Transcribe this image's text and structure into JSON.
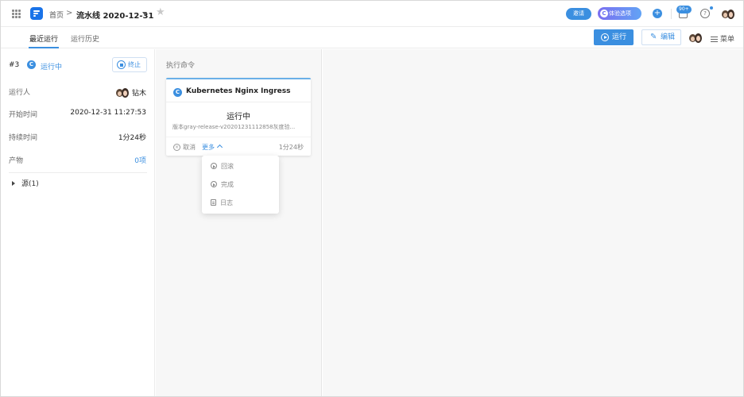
{
  "header": {
    "breadcrumb_home": "首页",
    "breadcrumb_sep": ">",
    "breadcrumb_current": "流水线 2020-12-31",
    "invite_label": "邀请",
    "trial_label": "体验选项",
    "trial_logo": "C",
    "plus_label": "+",
    "notif_badge": "90+",
    "help_label": "?"
  },
  "tabs": [
    {
      "label": "最近运行",
      "active": true
    },
    {
      "label": "运行历史",
      "active": false
    }
  ],
  "actions": {
    "run_label": "运行",
    "edit_label": "编辑",
    "edit_icon": "✎",
    "menu_label": "菜单"
  },
  "run": {
    "number": "#3",
    "status_icon": "C",
    "status": "运行中",
    "stop_label": "终止",
    "fields": [
      {
        "label": "运行人",
        "value": "钻木"
      },
      {
        "label": "开始时间",
        "value": "2020-12-31 11:27:53"
      },
      {
        "label": "持续时间",
        "value": "1分24秒"
      },
      {
        "label": "产物",
        "value": "0项"
      }
    ],
    "source_label": "源(1)"
  },
  "stage": {
    "title": "执行命令",
    "card": {
      "icon": "C",
      "title": "Kubernetes Nginx Ingress",
      "status": "运行中",
      "version": "版本gray-release-v20201231112858灰度验...",
      "cancel_icon": "×",
      "cancel_label": "取消",
      "more_label": "更多",
      "duration": "1分24秒"
    },
    "dropdown": [
      "回滚",
      "完成",
      "日志"
    ]
  },
  "colors": {
    "accent": "#3b8fe0",
    "panel_bg": "#f7f7f7"
  }
}
